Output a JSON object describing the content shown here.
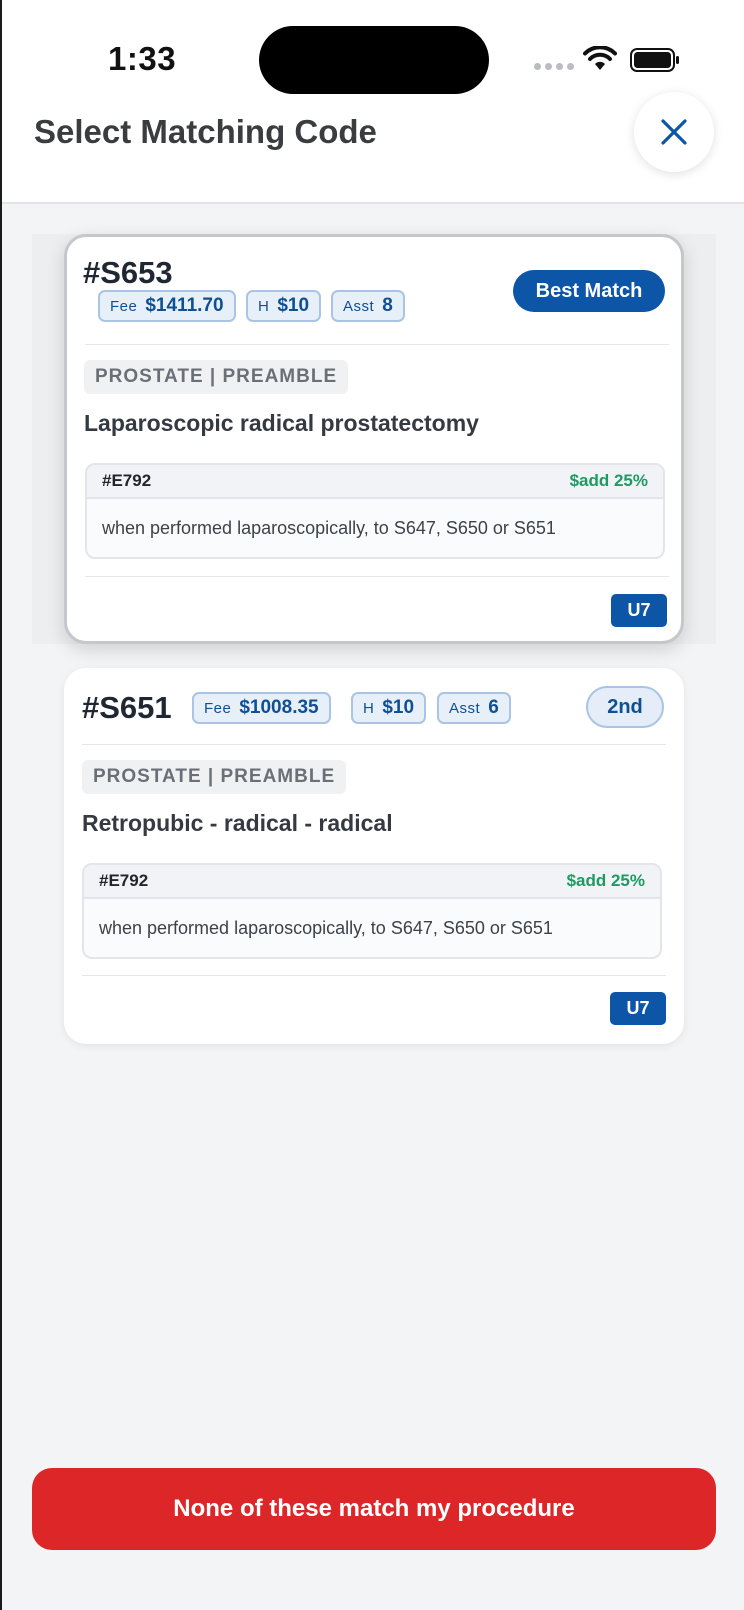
{
  "status_bar": {
    "time": "1:33"
  },
  "header": {
    "title": "Select Matching Code"
  },
  "matches": [
    {
      "code": "#S653",
      "fee_label": "Fee",
      "fee": "$1411.70",
      "h_label": "H",
      "h": "$10",
      "asst_label": "Asst",
      "asst": "8",
      "badge": "Best Match",
      "category": "PROSTATE | PREAMBLE",
      "description": "Laparoscopic radical prostatectomy",
      "modifier": {
        "code": "#E792",
        "add": "$add 25%",
        "text": "when performed laparoscopically, to S647, S650 or S651"
      },
      "unit": "U7"
    },
    {
      "code": "#S651",
      "fee_label": "Fee",
      "fee": "$1008.35",
      "h_label": "H",
      "h": "$10",
      "asst_label": "Asst",
      "asst": "6",
      "badge": "2nd",
      "category": "PROSTATE | PREAMBLE",
      "description": "Retropubic - radical - radical",
      "modifier": {
        "code": "#E792",
        "add": "$add 25%",
        "text": "when performed laparoscopically, to S647, S650 or S651"
      },
      "unit": "U7"
    }
  ],
  "footer": {
    "none_label": "None of these match my procedure"
  },
  "colors": {
    "accent": "#0d55a6",
    "danger": "#dd2628",
    "positive": "#1f9a63"
  }
}
